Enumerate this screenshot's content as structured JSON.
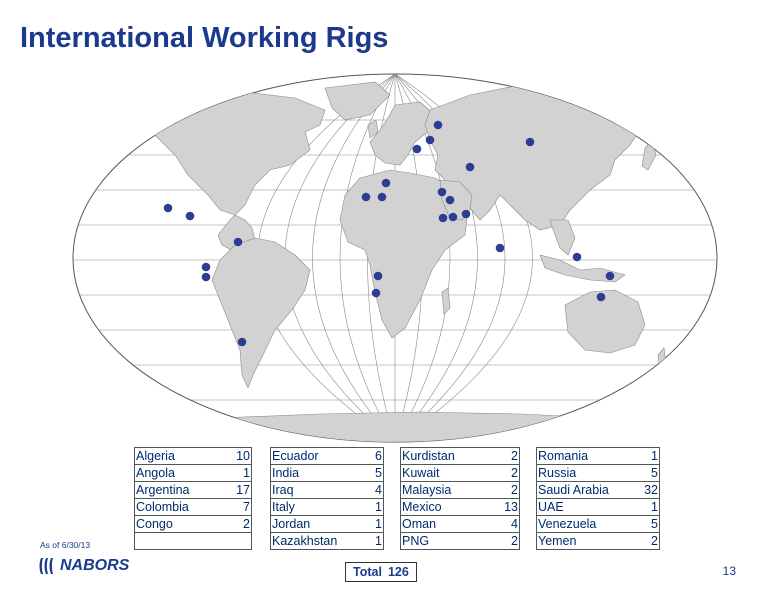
{
  "title": "International Working Rigs",
  "as_of": "As of 6/30/13",
  "logo_text": "NABORS",
  "total_label": "Total",
  "total_value": "126",
  "page_number": "13",
  "colors": {
    "title": "#1c3a8c",
    "marker": "#2b3e94",
    "land": "#d2d2d2",
    "water": "#ffffff"
  },
  "rig_counts": [
    [
      {
        "country": "Algeria",
        "count": "10"
      },
      {
        "country": "Angola",
        "count": "1"
      },
      {
        "country": "Argentina",
        "count": "17"
      },
      {
        "country": "Colombia",
        "count": "7"
      },
      {
        "country": "Congo",
        "count": "2"
      },
      {
        "country": "",
        "count": ""
      }
    ],
    [
      {
        "country": "Ecuador",
        "count": "6"
      },
      {
        "country": "India",
        "count": "5"
      },
      {
        "country": "Iraq",
        "count": "4"
      },
      {
        "country": "Italy",
        "count": "1"
      },
      {
        "country": "Jordan",
        "count": "1"
      },
      {
        "country": "Kazakhstan",
        "count": "1"
      }
    ],
    [
      {
        "country": "Kurdistan",
        "count": "2"
      },
      {
        "country": "Kuwait",
        "count": "2"
      },
      {
        "country": "Malaysia",
        "count": "2"
      },
      {
        "country": "Mexico",
        "count": "13"
      },
      {
        "country": "Oman",
        "count": "4"
      },
      {
        "country": "PNG",
        "count": "2"
      }
    ],
    [
      {
        "country": "Romania",
        "count": "1"
      },
      {
        "country": "Russia",
        "count": "5"
      },
      {
        "country": "Saudi Arabia",
        "count": "32"
      },
      {
        "country": "UAE",
        "count": "1"
      },
      {
        "country": "Venezuela",
        "count": "5"
      },
      {
        "country": "Yemen",
        "count": "2"
      }
    ]
  ]
}
